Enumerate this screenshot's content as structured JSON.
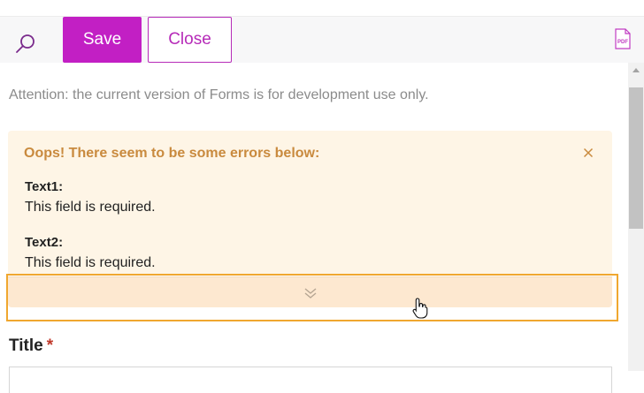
{
  "toolbar": {
    "save_label": "Save",
    "close_label": "Close",
    "search_icon": "search-icon",
    "pdf_icon": "pdf-icon",
    "pdf_text": "PDF"
  },
  "notice": "Attention: the current version of Forms is for development use only.",
  "errors": {
    "heading": "Oops! There seem to be some errors below:",
    "items": [
      {
        "field": "Text1:",
        "message": "This field is required."
      },
      {
        "field": "Text2:",
        "message": "This field is required."
      }
    ]
  },
  "form": {
    "title_label": "Title",
    "required_mark": "*"
  },
  "colors": {
    "accent": "#c21fc4",
    "error_bg": "#fef5e6",
    "error_text": "#c98a3e",
    "highlight": "#f0a72f"
  }
}
